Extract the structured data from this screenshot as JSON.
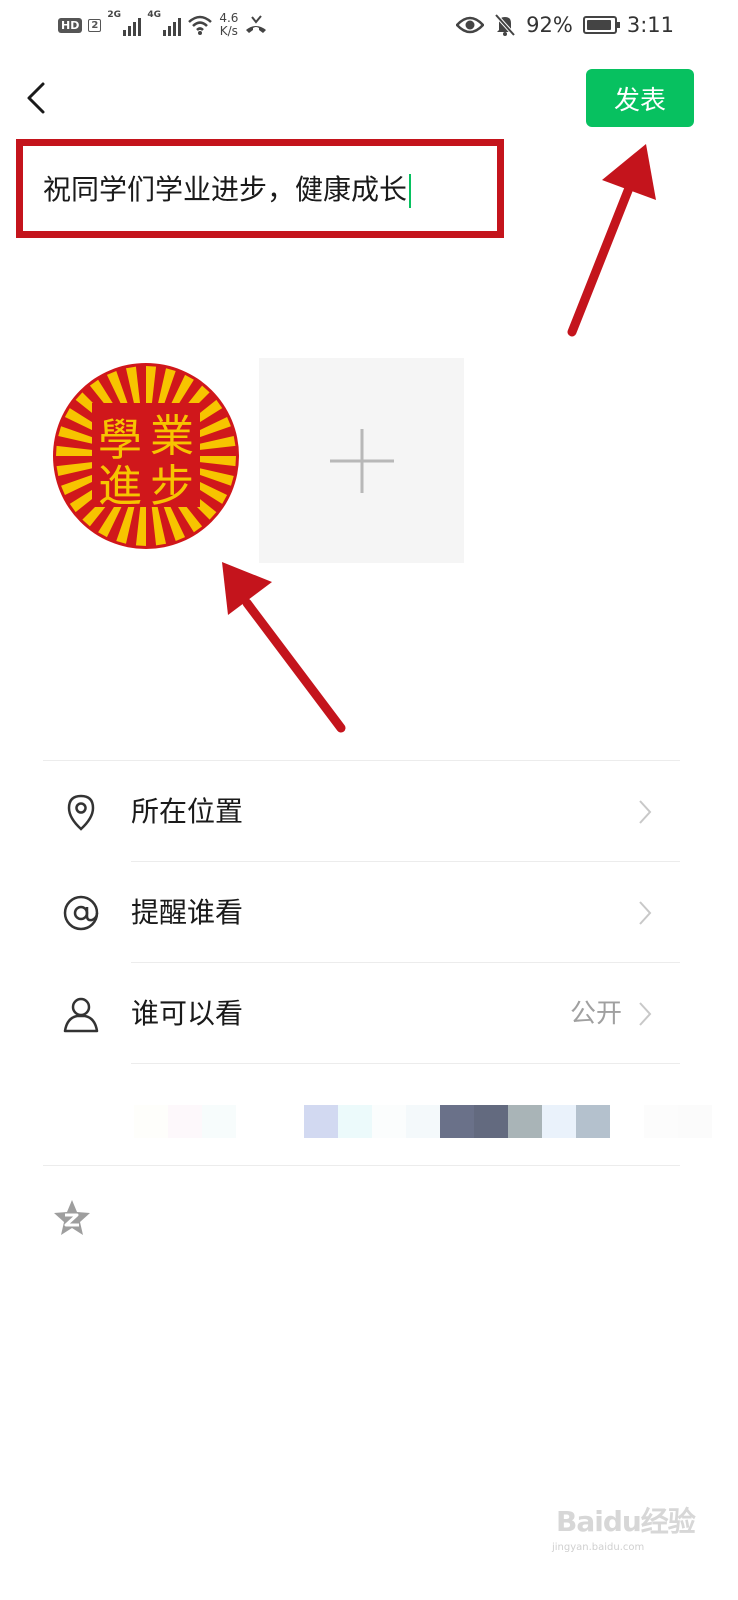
{
  "status_bar": {
    "hd_badge": "HD",
    "sim_badge": "2",
    "network_1": "2G",
    "network_2": "4G",
    "speed_value": "4.6",
    "speed_unit": "K/s",
    "battery_text": "92%",
    "battery_level": 0.92,
    "time": "3:11",
    "icons": [
      "hd-icon",
      "signal-icon",
      "signal-icon",
      "wifi-icon",
      "missed-call-icon",
      "eye-icon",
      "mute-bell-icon",
      "battery-icon"
    ]
  },
  "header": {
    "back_icon": "chevron-left-icon",
    "publish_label": "发表"
  },
  "composer": {
    "text": "祝同学们学业进步，健康成长"
  },
  "photos": {
    "badge_chars": [
      "學",
      "業",
      "進",
      "步"
    ],
    "add_icon": "plus-icon"
  },
  "options": [
    {
      "label": "所在位置",
      "icon": "location-pin-icon",
      "value": ""
    },
    {
      "label": "提醒谁看",
      "icon": "at-sign-icon",
      "value": ""
    },
    {
      "label": "谁可以看",
      "icon": "person-icon",
      "value": "公开"
    }
  ],
  "blurred_strip_colors": [
    "#fefefb",
    "#fdf8fb",
    "#f7fcfc",
    "#ffffff",
    "#ffffff",
    "#d2d9f1",
    "#ecfafb",
    "#fbfdfd",
    "#f4f9fb",
    "#6a7189",
    "#636a7f",
    "#a9b4b7",
    "#eaf2fb",
    "#b4c1cd",
    "#ffffff",
    "#fcfcfc",
    "#fbfbfb"
  ],
  "footer": {
    "qzone_icon": "qzone-star-icon"
  },
  "watermark": {
    "text": "Baidu经验",
    "url": "jingyan.baidu.com"
  },
  "colors": {
    "accent_green": "#07c160",
    "annotation_red": "#c4141c",
    "badge_red": "#d0171b",
    "badge_yellow": "#f7c400"
  }
}
